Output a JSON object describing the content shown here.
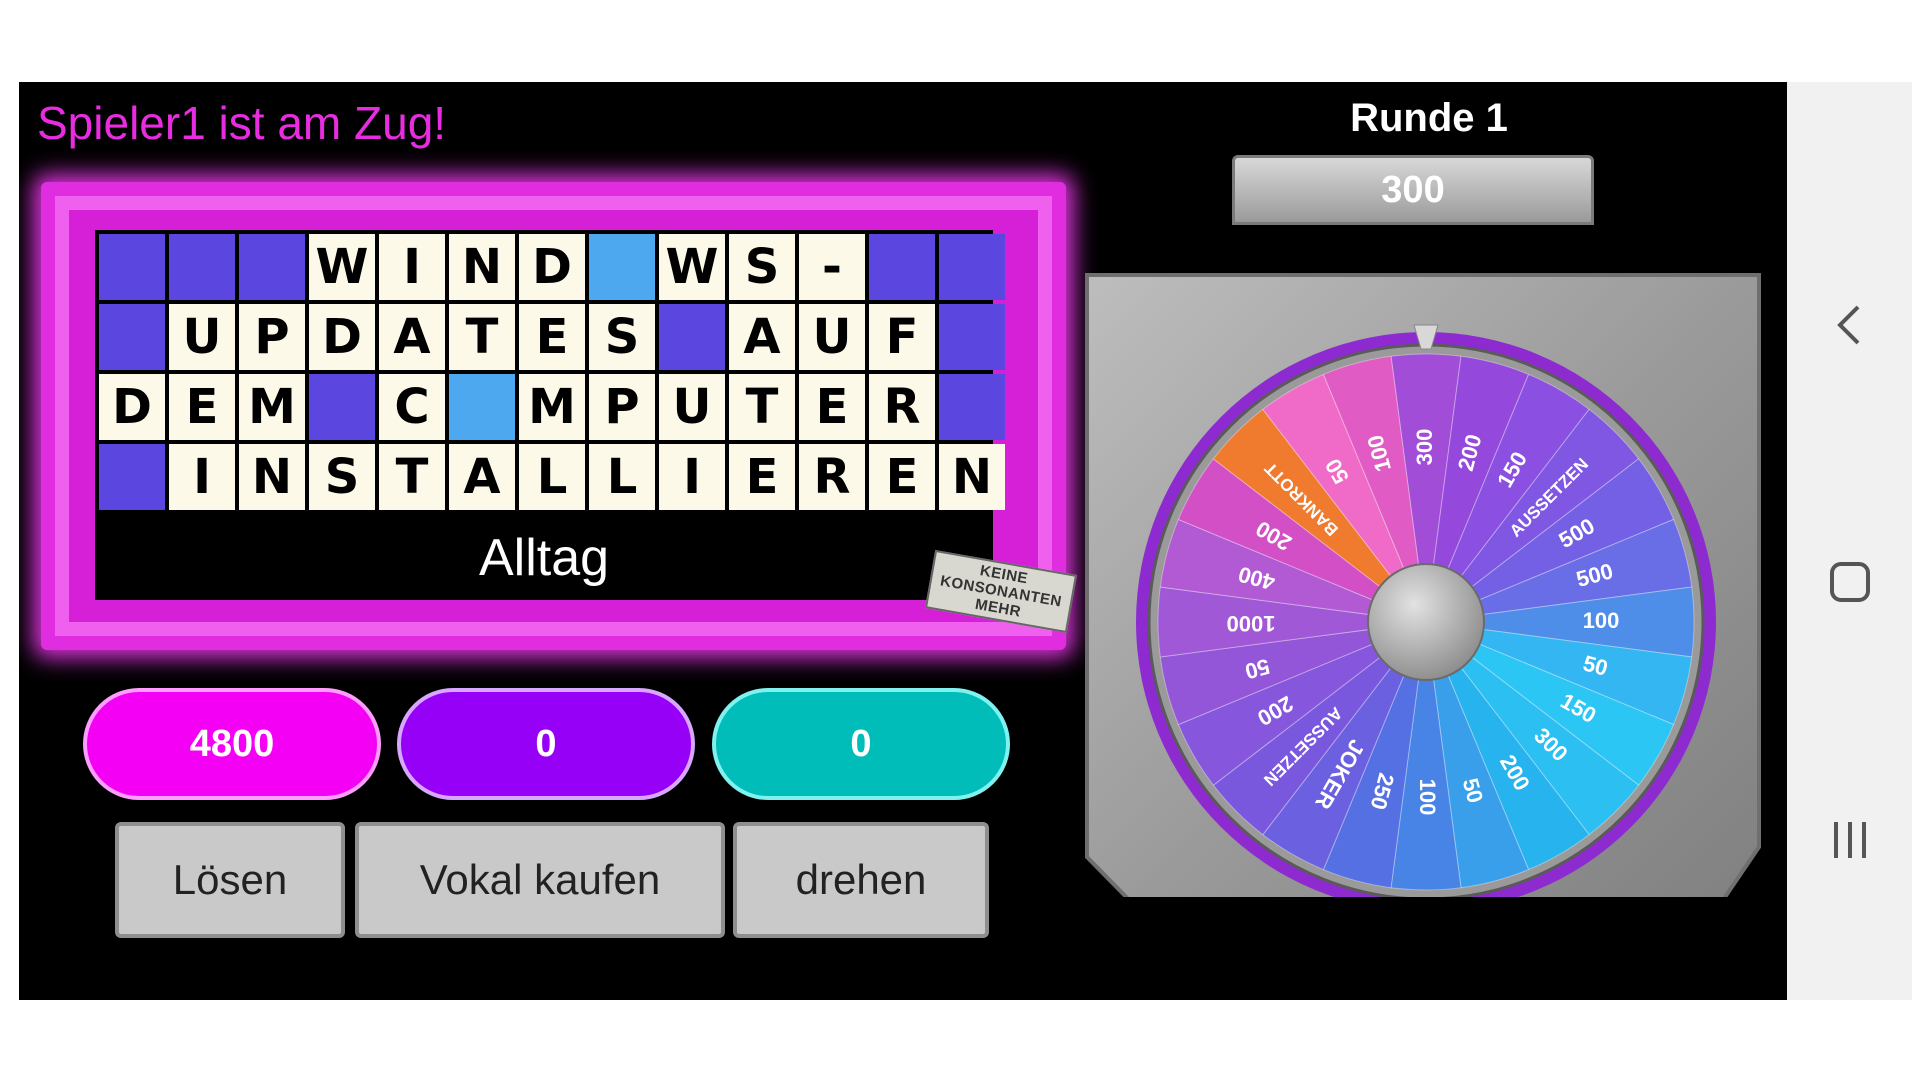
{
  "turn_text": "Spieler1 ist am Zug!",
  "round_title": "Runde 1",
  "current_value": "300",
  "board": {
    "rows": [
      [
        "",
        "",
        "",
        "W",
        "I",
        "N",
        "D",
        "*",
        "W",
        "S",
        "-",
        "",
        ""
      ],
      [
        "",
        "U",
        "P",
        "D",
        "A",
        "T",
        "E",
        "S",
        "",
        "A",
        "U",
        "F",
        ""
      ],
      [
        "D",
        "E",
        "M",
        "",
        "C",
        "*",
        "M",
        "P",
        "U",
        "T",
        "E",
        "R",
        ""
      ],
      [
        "",
        "I",
        "N",
        "S",
        "T",
        "A",
        "L",
        "L",
        "I",
        "E",
        "R",
        "E",
        "N"
      ]
    ],
    "category": "Alltag",
    "colors": {
      "empty": "#5b46e0",
      "letter": "#fdf9e8",
      "hidden": "#4da8f0"
    }
  },
  "no_consonants_badge": [
    "KEINE",
    "KONSONANTEN",
    "MEHR"
  ],
  "scores": [
    "4800",
    "0",
    "0"
  ],
  "buttons": {
    "solve": "Lösen",
    "buy_vowel": "Vokal kaufen",
    "spin": "drehen"
  },
  "wheel": {
    "segments": [
      {
        "label": "300",
        "color": "#a24dd8"
      },
      {
        "label": "200",
        "color": "#9448dc"
      },
      {
        "label": "150",
        "color": "#8b50e2"
      },
      {
        "label": "AUSSETZEN",
        "color": "#7f57e2"
      },
      {
        "label": "500",
        "color": "#7460e4"
      },
      {
        "label": "500",
        "color": "#6a6ee6"
      },
      {
        "label": "100",
        "color": "#4e8ee8"
      },
      {
        "label": "50",
        "color": "#34b6f2"
      },
      {
        "label": "150",
        "color": "#2cc6f4"
      },
      {
        "label": "300",
        "color": "#2bbff2"
      },
      {
        "label": "200",
        "color": "#27b3ee"
      },
      {
        "label": "50",
        "color": "#3a9fea"
      },
      {
        "label": "100",
        "color": "#4784e6"
      },
      {
        "label": "250",
        "color": "#5470e2"
      },
      {
        "label": "JOKER",
        "color": "#6b60e0"
      },
      {
        "label": "AUSSETZEN",
        "color": "#7a58de"
      },
      {
        "label": "200",
        "color": "#8656dc"
      },
      {
        "label": "50",
        "color": "#9456d8"
      },
      {
        "label": "1000",
        "color": "#a058d6"
      },
      {
        "label": "400",
        "color": "#b25ad4"
      },
      {
        "label": "200",
        "color": "#d24fc6"
      },
      {
        "label": "BANKROTT",
        "color": "#f07a2e"
      },
      {
        "label": "50",
        "color": "#f06bc8"
      },
      {
        "label": "100",
        "color": "#e05cc4"
      }
    ]
  }
}
